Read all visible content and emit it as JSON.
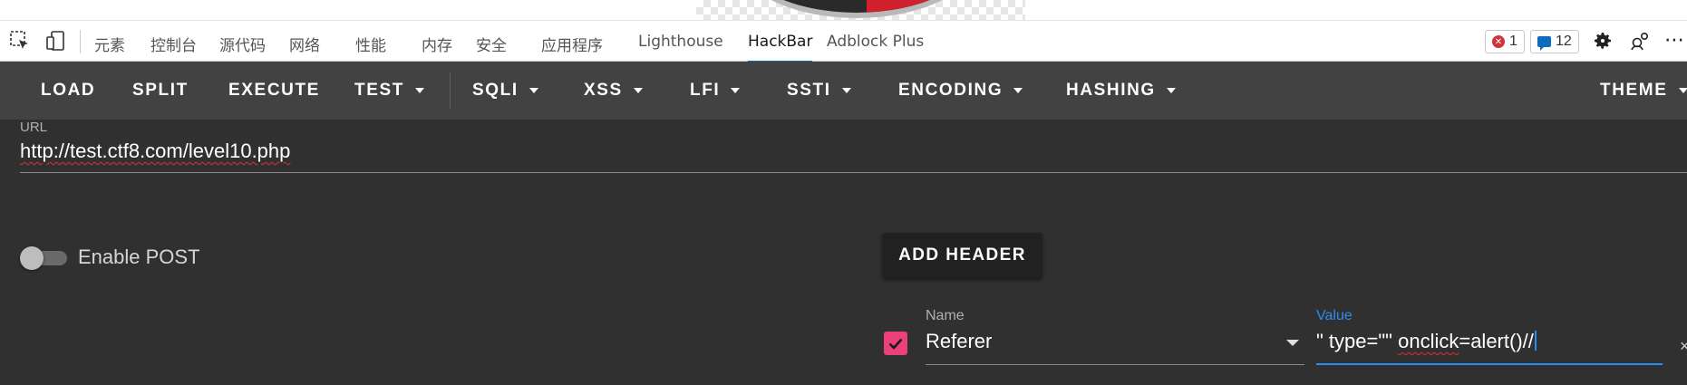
{
  "devtools": {
    "tabs": [
      {
        "label": "元素",
        "active": false
      },
      {
        "label": "控制台",
        "active": false
      },
      {
        "label": "源代码",
        "active": false
      },
      {
        "label": "网络",
        "active": false
      },
      {
        "label": "性能",
        "active": false
      },
      {
        "label": "内存",
        "active": false
      },
      {
        "label": "安全",
        "active": false
      },
      {
        "label": "应用程序",
        "active": false
      },
      {
        "label": "Lighthouse",
        "active": false
      },
      {
        "label": "HackBar",
        "active": true
      },
      {
        "label": "Adblock Plus",
        "active": false
      }
    ],
    "error_count": "1",
    "message_count": "12",
    "icons": [
      "inspect-element-icon",
      "device-emulation-icon",
      "error-icon",
      "message-icon",
      "settings-gear-icon",
      "customize-icon",
      "more-icon"
    ]
  },
  "hackbar": {
    "toolbar": {
      "load": "LOAD",
      "split": "SPLIT",
      "execute": "EXECUTE",
      "test": "TEST",
      "sqli": "SQLI",
      "xss": "XSS",
      "lfi": "LFI",
      "ssti": "SSTI",
      "encoding": "ENCODING",
      "hashing": "HASHING",
      "theme": "THEME"
    },
    "url_label": "URL",
    "url_value": "http://test.ctf8.com/level10.php",
    "enable_post_label": "Enable POST",
    "enable_post": false,
    "add_header_label": "ADD HEADER",
    "header": {
      "enabled": true,
      "name_label": "Name",
      "name_value": "Referer",
      "value_label": "Value",
      "value_value_prefix": "\" type=\"\" ",
      "value_value_squiggle": "onclick",
      "value_value_suffix": "=alert()//"
    }
  },
  "colors": {
    "toolbar_bg": "#424242",
    "body_bg": "#303030",
    "accent_blue": "#2d8cf0",
    "checkbox_pink": "#ec407a",
    "devtools_active_underline": "#0f6cbd"
  }
}
